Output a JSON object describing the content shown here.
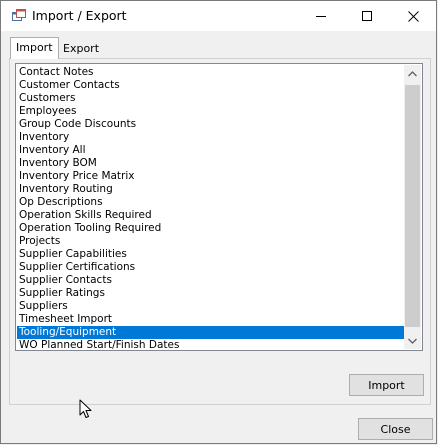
{
  "window": {
    "title": "Import / Export"
  },
  "tabs": [
    {
      "label": "Import",
      "active": true
    },
    {
      "label": "Export",
      "active": false
    }
  ],
  "list": {
    "items": [
      "Contact Notes",
      "Customer Contacts",
      "Customers",
      "Employees",
      "Group Code Discounts",
      "Inventory",
      "Inventory All",
      "Inventory BOM",
      "Inventory Price Matrix",
      "Inventory Routing",
      "Op Descriptions",
      "Operation Skills Required",
      "Operation Tooling Required",
      "Projects",
      "Supplier Capabilities",
      "Supplier Certifications",
      "Supplier Contacts",
      "Supplier Ratings",
      "Suppliers",
      "Timesheet Import",
      "Tooling/Equipment",
      "WO Planned Start/Finish Dates"
    ],
    "selected": "Tooling/Equipment"
  },
  "buttons": {
    "import_label": "Import",
    "close_label": "Close"
  },
  "colors": {
    "selection": "#0078d7",
    "window_bg": "#f0f0f0"
  },
  "icons": {
    "app": "app-window-icon",
    "minimize": "minimize-icon",
    "maximize": "maximize-icon",
    "close": "close-icon",
    "scroll_up": "chevron-up-icon",
    "scroll_down": "chevron-down-icon",
    "cursor": "mouse-pointer-icon"
  }
}
